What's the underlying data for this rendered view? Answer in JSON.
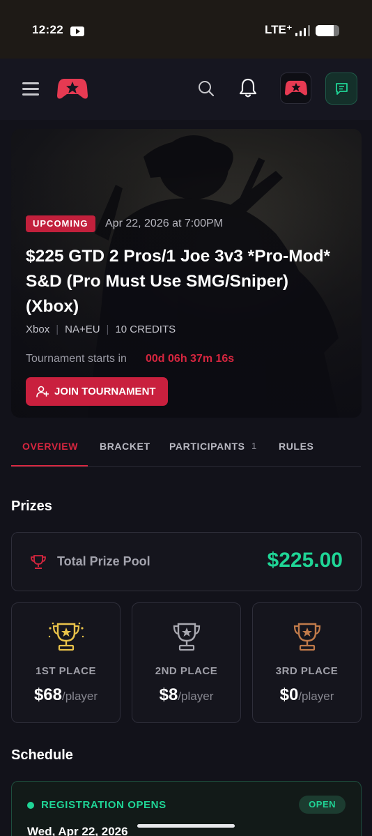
{
  "status_bar": {
    "time": "12:22",
    "network": "LTE⁺",
    "battery_level": 0.75
  },
  "header": {
    "menu_icon": "hamburger-icon",
    "logo_icon": "game-controller-logo",
    "search_icon": "search-icon",
    "notification_icon": "bell-icon",
    "chat_icon": "chat-icon",
    "accent": "#c9203e"
  },
  "hero": {
    "status_badge": "UPCOMING",
    "date": "Apr 22, 2026 at 7:00PM",
    "title": "$225 GTD 2 Pros/1 Joe 3v3 *Pro-Mod* S&D (Pro Must Use SMG/Sniper)(Xbox)",
    "platform": "Xbox",
    "region": "NA+EU",
    "credits": "10 CREDITS",
    "starts_label": "Tournament starts in",
    "countdown": "00d 06h 37m 16s",
    "join_label": "JOIN TOURNAMENT"
  },
  "tabs": [
    {
      "label": "OVERVIEW",
      "active": true
    },
    {
      "label": "BRACKET",
      "active": false
    },
    {
      "label": "PARTICIPANTS",
      "count": "1",
      "active": false
    },
    {
      "label": "RULES",
      "active": false
    }
  ],
  "prizes": {
    "heading": "Prizes",
    "pool_label": "Total Prize Pool",
    "pool_amount": "$225.00",
    "places": [
      {
        "label": "1ST PLACE",
        "amount": "$68",
        "unit": "/player",
        "color": "#e8c24a"
      },
      {
        "label": "2ND PLACE",
        "amount": "$8",
        "unit": "/player",
        "color": "#a8a8b0"
      },
      {
        "label": "3RD PLACE",
        "amount": "$0",
        "unit": "/player",
        "color": "#c07a4a"
      }
    ]
  },
  "schedule": {
    "heading": "Schedule",
    "items": [
      {
        "label": "REGISTRATION OPENS",
        "status": "OPEN",
        "date": "Wed, Apr 22, 2026"
      }
    ]
  }
}
